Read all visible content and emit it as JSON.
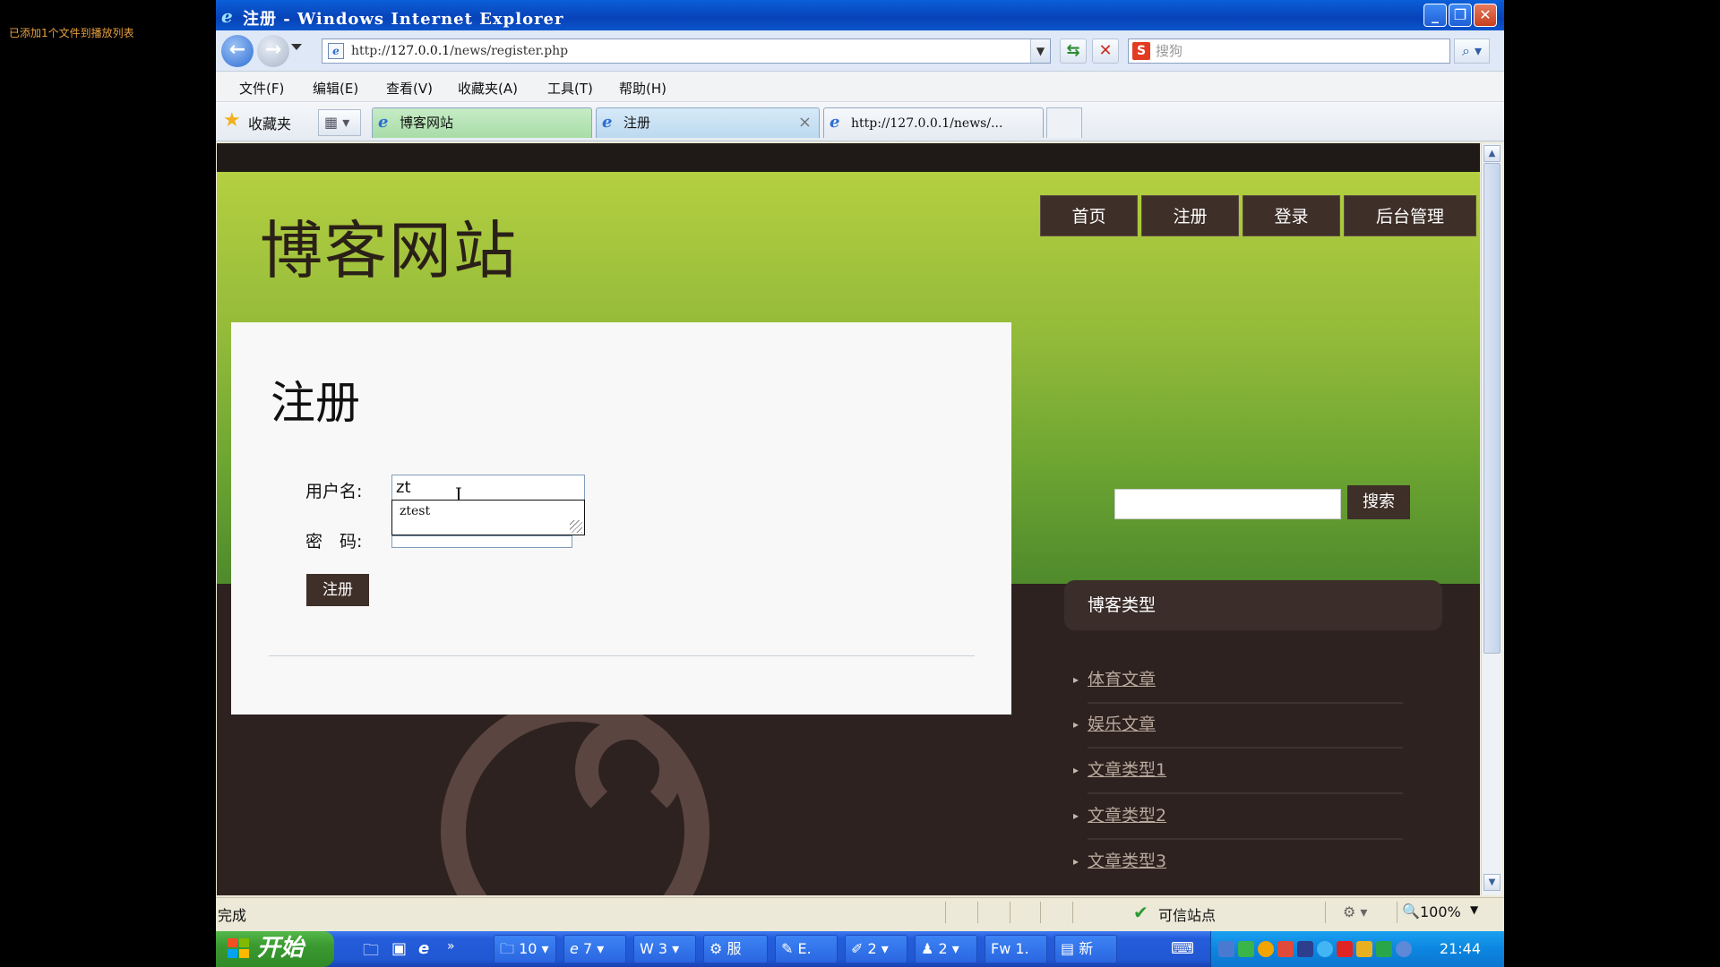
{
  "notice": "已添加1个文件到播放列表",
  "window": {
    "title": "注册 - Windows Internet Explorer",
    "min_icon": "minimize-icon",
    "max_icon": "restore-icon",
    "close_icon": "close-icon"
  },
  "address": {
    "url_prefix": "http://",
    "url_host": "127.0.0.1",
    "url_path": "/news/register.php",
    "search_placeholder": "搜狗"
  },
  "menu": [
    "文件(F)",
    "编辑(E)",
    "查看(V)",
    "收藏夹(A)",
    "工具(T)",
    "帮助(H)"
  ],
  "favorites": {
    "label": "收藏夹"
  },
  "tabs": [
    {
      "label": "博客网站",
      "active": false
    },
    {
      "label": "注册",
      "active": true
    },
    {
      "label": "http://127.0.0.1/news/...",
      "active": false
    }
  ],
  "site": {
    "title": "博客网站",
    "nav": [
      "首页",
      "注册",
      "登录",
      "后台管理"
    ],
    "search_button": "搜索",
    "category_title": "博客类型",
    "categories": [
      "体育文章",
      "娱乐文章",
      "文章类型1",
      "文章类型2",
      "文章类型3"
    ]
  },
  "form": {
    "heading": "注册",
    "username_label": "用户名:",
    "username_value": "zt",
    "autocomplete_suggestion": "ztest",
    "password_label": "密　码:",
    "password_value": "",
    "submit_label": "注册"
  },
  "status": {
    "text": "完成",
    "zone": "可信站点",
    "zoom": "100%"
  },
  "taskbar": {
    "start_label": "开始",
    "buttons": [
      "10",
      "7",
      "3",
      "服",
      "E.",
      "2",
      "2",
      "1.",
      "新"
    ],
    "clock": "21:44"
  },
  "colors": {
    "nav_bg": "#3e2f28",
    "header_green": "#93ba3a",
    "panel_bg": "#f8f8f8"
  }
}
